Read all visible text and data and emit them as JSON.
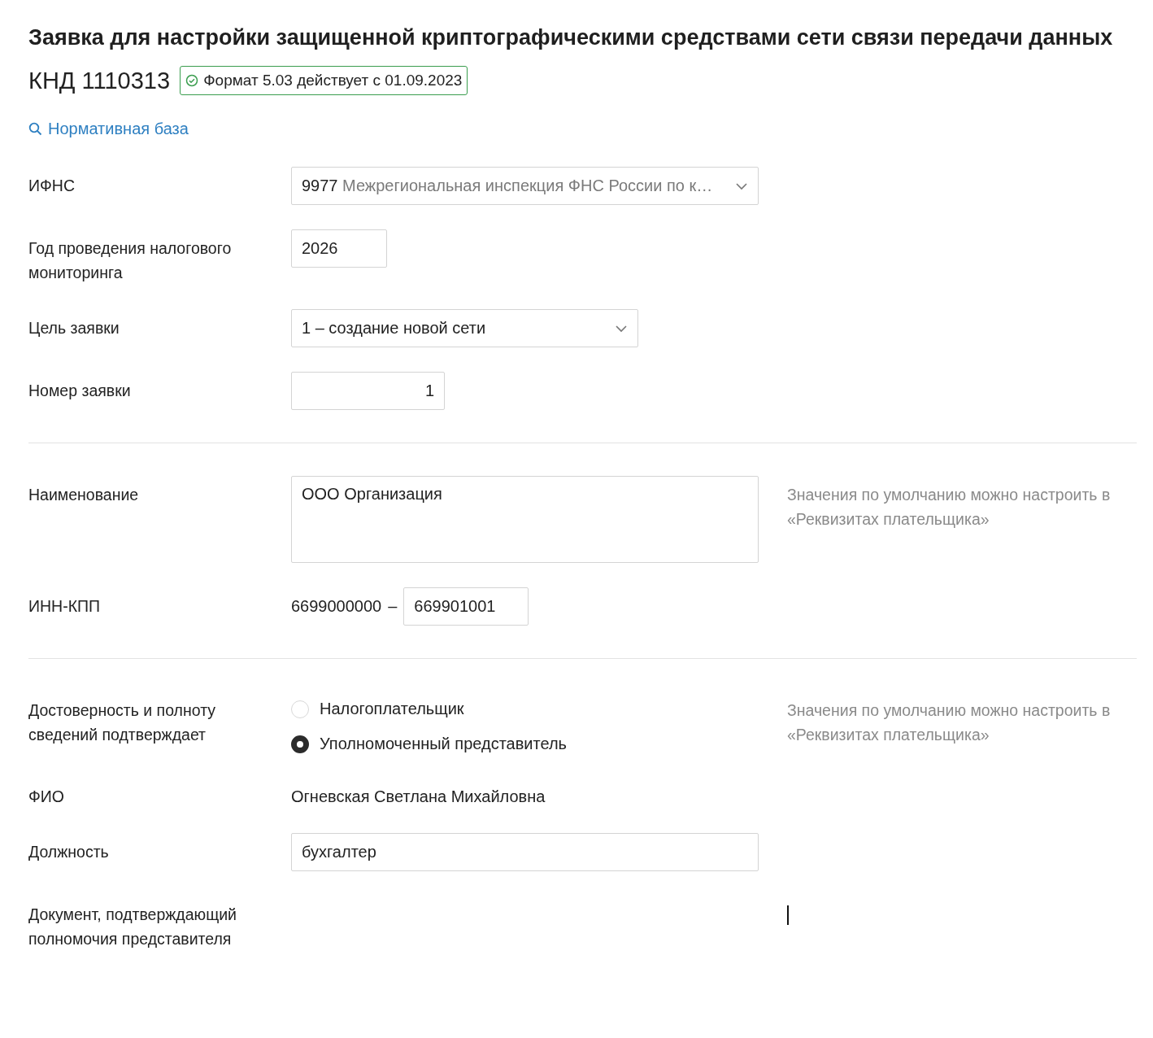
{
  "title": "Заявка для настройки защищенной криптографическими средствами сети связи передачи данных",
  "knd": "КНД 1110313",
  "format_badge": "Формат 5.03 действует с 01.09.2023",
  "link": "Нормативная база",
  "sections": [
    [
      {
        "kind": "select",
        "label": "ИФНС",
        "code": "9977",
        "value": "Межрегиональная инспекция ФНС России по к…"
      },
      {
        "kind": "input",
        "label": "Год проведения налогового мониторинга",
        "value": "2026"
      },
      {
        "kind": "select",
        "label": "Цель заявки",
        "value": "1 – создание новой сети"
      },
      {
        "kind": "number",
        "label": "Номер заявки",
        "value": "1"
      }
    ],
    [
      {
        "kind": "textarea",
        "label": "Наименование",
        "value": "ООО Организация",
        "hint": "Значения по умолчанию можно настроить в «Реквизитах плательщика»"
      },
      {
        "kind": "inn",
        "label": "ИНН-КПП",
        "inn": "6699000000",
        "separator": "–",
        "value": "669901001"
      }
    ],
    [
      {
        "kind": "radio",
        "label": "Достоверность и полноту сведений подтверждает",
        "hint": "Значения по умолчанию можно настроить в «Реквизитах плательщика»",
        "options": [
          {
            "label": "Налогоплательщик",
            "selected": false
          },
          {
            "label": "Уполномоченный представитель",
            "selected": true
          }
        ]
      },
      {
        "kind": "static",
        "label": "ФИО",
        "value": "Огневская Светлана Михайловна"
      },
      {
        "kind": "input",
        "label": "Должность",
        "value": "бухгалтер"
      },
      {
        "kind": "cursor",
        "label": "Документ, подтверждающий полномочия представителя"
      }
    ]
  ]
}
